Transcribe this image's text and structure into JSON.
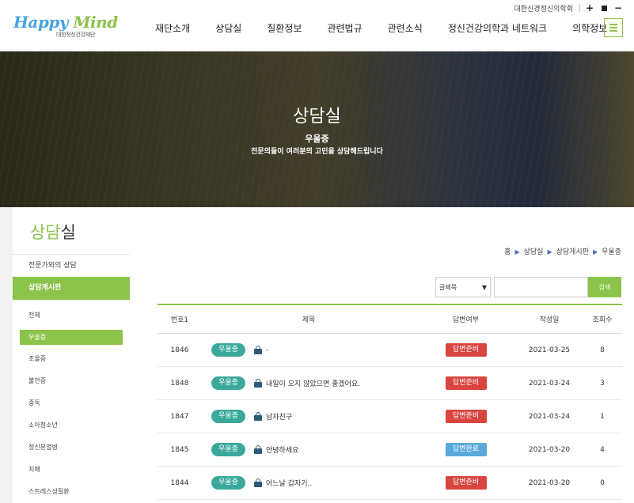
{
  "colors": {
    "accent_green": "#8cc34b",
    "tag_teal": "#3aa99a",
    "status_pending": "#d9453f",
    "status_done": "#5aa9dc"
  },
  "header": {
    "logo_happy": "Happy",
    "logo_mind": "Mind",
    "logo_sub": "대한정신건강재단",
    "org_link": "대한신경정신의학회",
    "nav": [
      "재단소개",
      "상담실",
      "질환정보",
      "관련법규",
      "관련소식",
      "정신건강의학과 네트워크",
      "의학정보"
    ],
    "menu_icon": "hamburger-icon"
  },
  "hero": {
    "title": "상담실",
    "subtitle": "우울증",
    "description": "전문의들이 여러분의 고민을 상담해드립니다"
  },
  "sidebar": {
    "title_accent": "상담",
    "title_rest": "실",
    "menu": [
      "전문가와의 상담",
      "상담게시판"
    ],
    "sub_items": [
      "전체",
      "우울증",
      "조울증",
      "불안증",
      "중독",
      "소아청소년",
      "정신분열병",
      "치매",
      "스트레스성질환"
    ]
  },
  "breadcrumb": [
    "홈",
    "상담실",
    "상담게시판",
    "우울증"
  ],
  "search": {
    "select_value": "글제목",
    "button": "검색"
  },
  "table": {
    "headers": [
      "번호1",
      "제목",
      "답변여부",
      "작성일",
      "조회수"
    ],
    "rows": [
      {
        "no": "1846",
        "tag": "우울증",
        "subject": "-",
        "status": "답변준비",
        "status_color": "#d9453f",
        "date": "2021-03-25",
        "views": "8"
      },
      {
        "no": "1848",
        "tag": "우울증",
        "subject": "내일이 오지 않았으면 좋겠어요.",
        "status": "답변준비",
        "status_color": "#d9453f",
        "date": "2021-03-24",
        "views": "3"
      },
      {
        "no": "1847",
        "tag": "우울증",
        "subject": "남자친구",
        "status": "답변준비",
        "status_color": "#d9453f",
        "date": "2021-03-24",
        "views": "1"
      },
      {
        "no": "1845",
        "tag": "우울증",
        "subject": "안녕하세요",
        "status": "답변완료",
        "status_color": "#5aa9dc",
        "date": "2021-03-20",
        "views": "4"
      },
      {
        "no": "1844",
        "tag": "우울증",
        "subject": "어느날 갑자기..",
        "status": "답변준비",
        "status_color": "#d9453f",
        "date": "2021-03-20",
        "views": "0"
      }
    ]
  }
}
